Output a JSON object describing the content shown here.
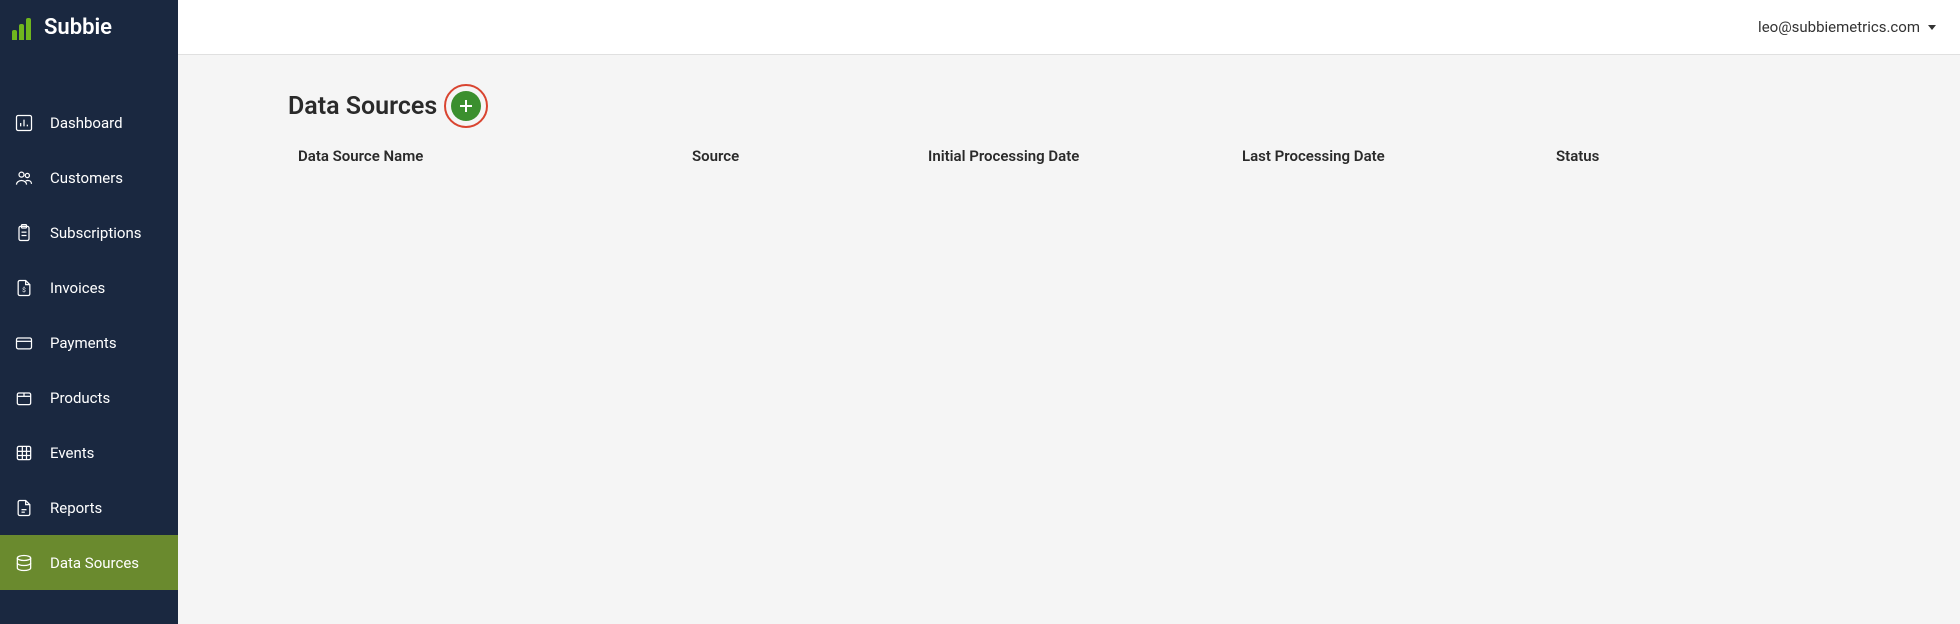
{
  "app": {
    "name": "Subbie"
  },
  "header": {
    "user_email": "leo@subbiemetrics.com"
  },
  "sidebar": {
    "items": [
      {
        "label": "Dashboard",
        "icon": "bar-chart",
        "active": false
      },
      {
        "label": "Customers",
        "icon": "users",
        "active": false
      },
      {
        "label": "Subscriptions",
        "icon": "clipboard",
        "active": false
      },
      {
        "label": "Invoices",
        "icon": "file-dollar",
        "active": false
      },
      {
        "label": "Payments",
        "icon": "credit-card",
        "active": false
      },
      {
        "label": "Products",
        "icon": "box",
        "active": false
      },
      {
        "label": "Events",
        "icon": "grid",
        "active": false
      },
      {
        "label": "Reports",
        "icon": "file",
        "active": false
      },
      {
        "label": "Data Sources",
        "icon": "database",
        "active": true
      }
    ]
  },
  "page": {
    "title": "Data Sources"
  },
  "table": {
    "columns": {
      "name": "Data Source Name",
      "source": "Source",
      "initial_date": "Initial Processing Date",
      "last_date": "Last Processing Date",
      "status": "Status"
    },
    "rows": []
  }
}
